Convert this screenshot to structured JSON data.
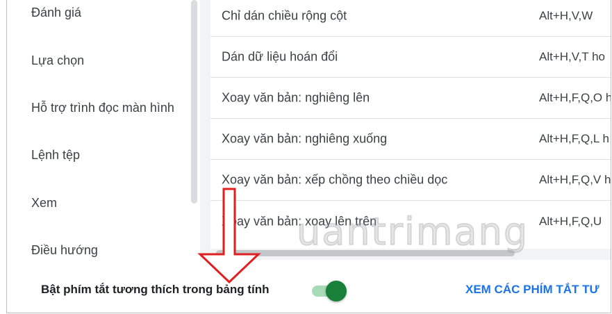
{
  "sidebar": {
    "items": [
      {
        "label": "Đánh giá"
      },
      {
        "label": "Lựa chọn"
      },
      {
        "label": "Hỗ trợ trình đọc màn hình"
      },
      {
        "label": "Lệnh tệp"
      },
      {
        "label": "Xem"
      },
      {
        "label": "Điều hướng"
      }
    ]
  },
  "shortcuts": {
    "rows": [
      {
        "action": "Chỉ dán chiều rộng cột",
        "keys": "Alt+H,V,W"
      },
      {
        "action": "Dán dữ liệu hoán đổi",
        "keys": "Alt+H,V,T ho"
      },
      {
        "action": "Xoay văn bản: nghiêng lên",
        "keys": "Alt+H,F,Q,O h"
      },
      {
        "action": "Xoay văn bản: nghiêng xuống",
        "keys": "Alt+H,F,Q,L h"
      },
      {
        "action": "Xoay văn bản: xếp chồng theo chiều dọc",
        "keys": "Alt+H,F,Q,V h"
      },
      {
        "action": "Xoay văn bản: xoay lên trên",
        "keys": "Alt+H,F,Q,U"
      }
    ]
  },
  "footer": {
    "compat_label": "Bật phím tắt tương thích trong bảng tính",
    "toggle_on": true,
    "view_link": "XEM CÁC PHÍM TẮT TƯ"
  },
  "watermark": "uantrimang",
  "colors": {
    "accent_link": "#1a73e8",
    "toggle_knob": "#188038",
    "toggle_track": "#a8dab5",
    "arrow": "#e02020"
  }
}
